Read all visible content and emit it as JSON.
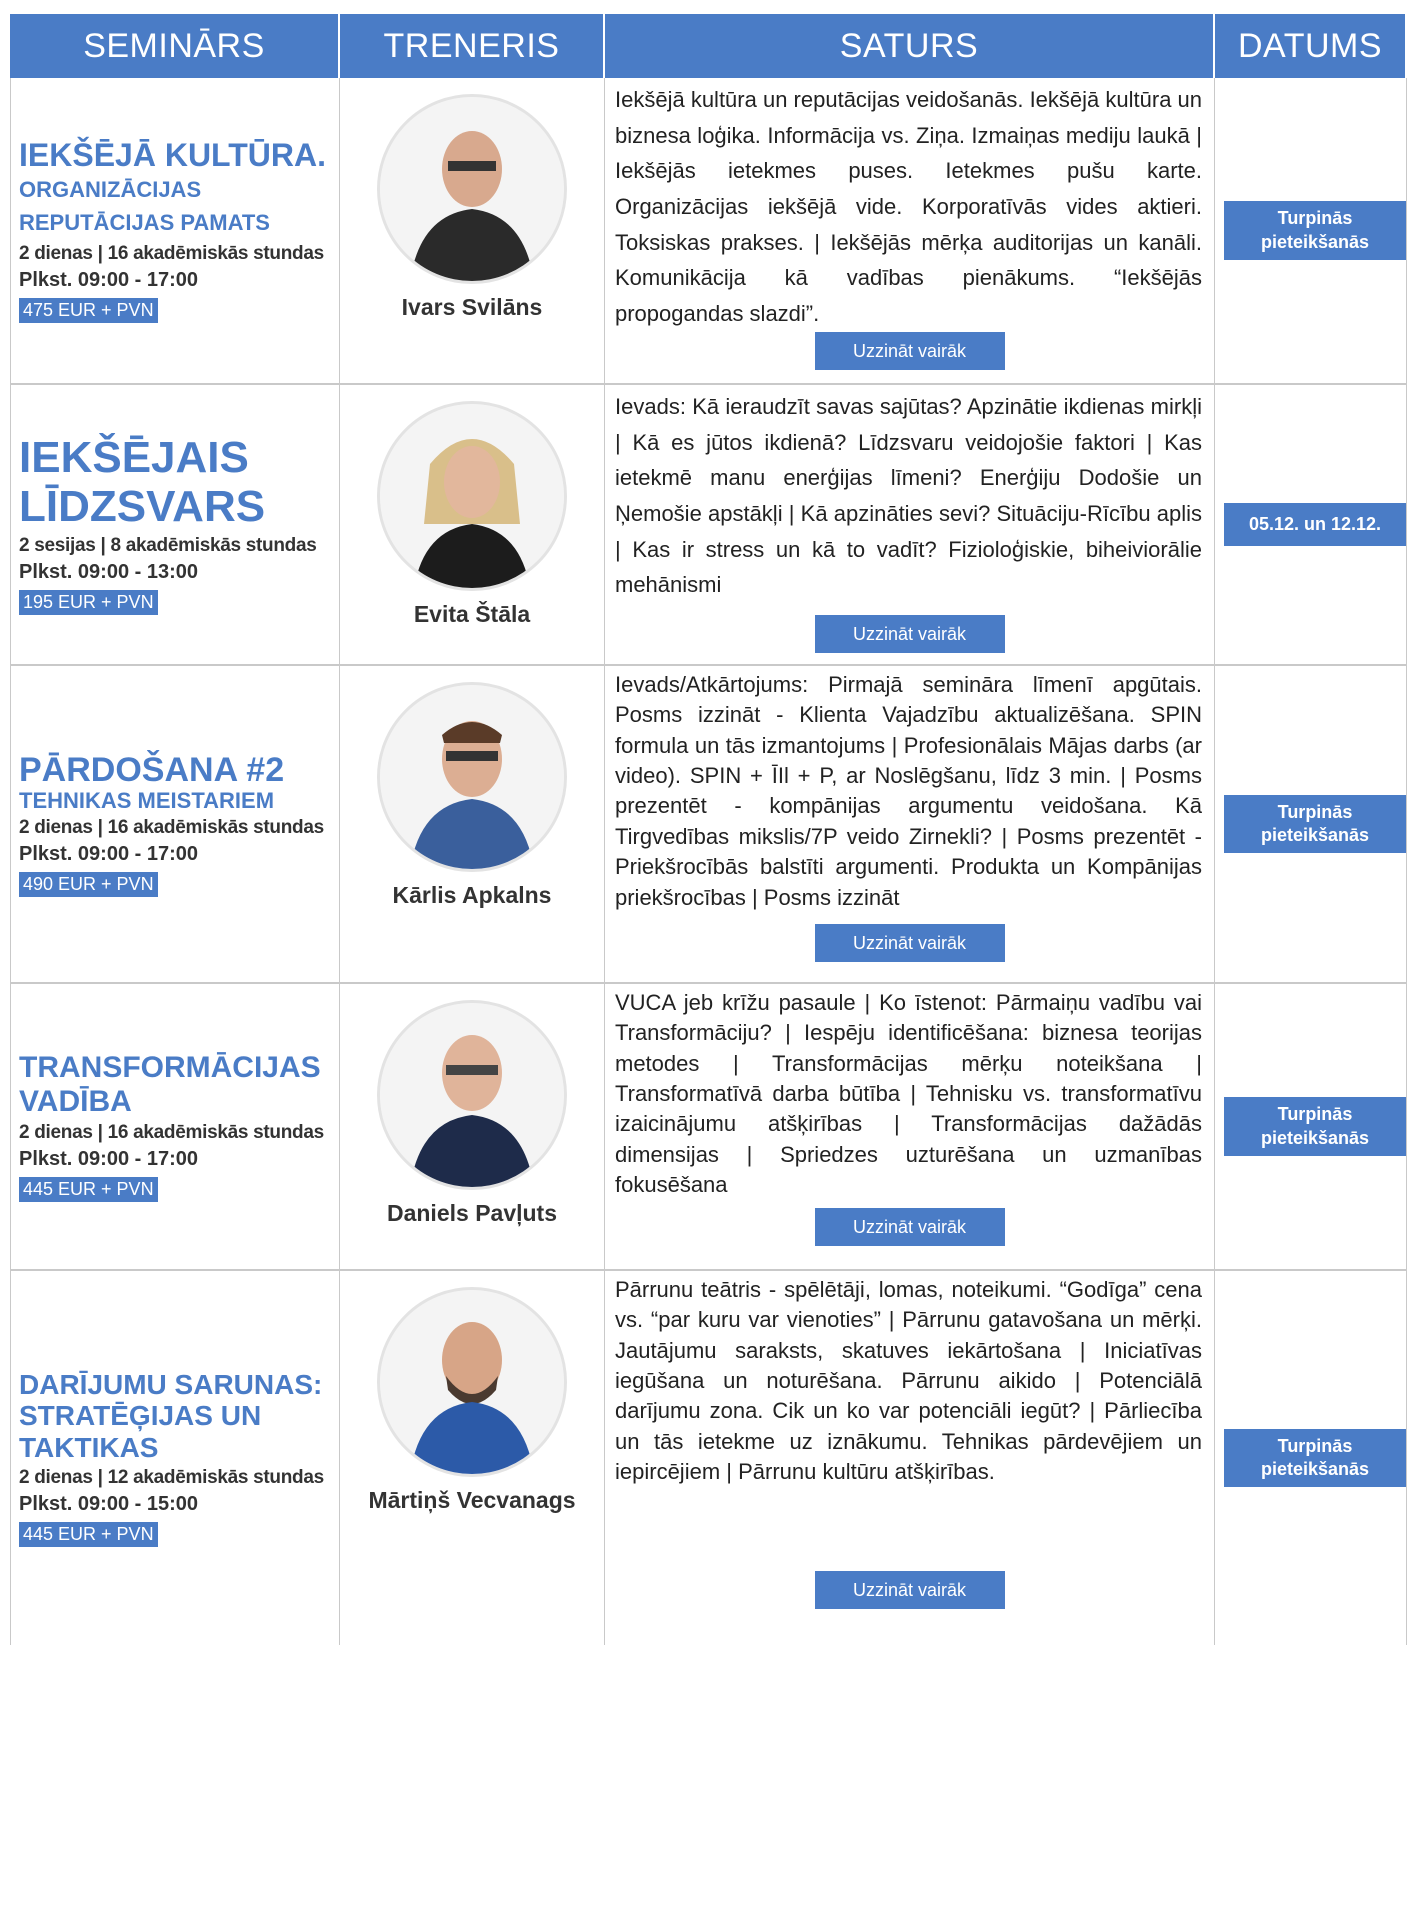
{
  "header": {
    "col1": "SEMINĀRS",
    "col2": "TRENERIS",
    "col3": "SATURS",
    "col4": "DATUMS"
  },
  "rows": [
    {
      "title": "IEKŠĒJĀ KULTŪRA.",
      "subtitle": "ORGANIZĀCIJAS REPUTĀCIJAS PAMATS",
      "duration": "2 dienas | 16 akadēmiskās stundas",
      "time": "Plkst. 09:00 - 17:00",
      "price": "475 EUR + PVN",
      "trainer": "Ivars Svilāns",
      "content": "Iekšējā kultūra un reputācijas veidošanās. Iekšējā kultūra un biznesa loģika. Informācija vs. Ziņa. Izmaiņas mediju laukā | Iekšējās ietekmes puses. Ietekmes pušu karte. Organizācijas iekšējā vide. Korporatīvās vides aktieri. Toksiskas prakses. | Iekšējās mērķa auditorijas un kanāli. Komunikācija kā vadības pienākums. “Iekšējās propogandas slazdi”.",
      "more": "Uzzināt vairāk",
      "date": "Turpinās pieteikšanās"
    },
    {
      "title": "IEKŠĒJAIS LĪDZSVARS",
      "subtitle": "",
      "duration": "2 sesijas | 8 akadēmiskās stundas",
      "time": "Plkst. 09:00 - 13:00",
      "price": "195 EUR + PVN",
      "trainer": "Evita Štāla",
      "content": "Ievads: Kā ieraudzīt savas sajūtas? Apzinātie ikdienas mirkļi | Kā es jūtos ikdienā? Līdzsvaru veidojošie faktori | Kas ietekmē manu enerģijas līmeni? Enerģiju Dodošie un Ņemošie apstākļi | Kā apzināties sevi? Situāciju-Rīcību aplis | Kas ir stress un kā to vadīt? Fizioloģiskie, biheiviorālie mehānismi",
      "more": "Uzzināt vairāk",
      "date": "05.12. un 12.12."
    },
    {
      "title": "PĀRDOŠANA #2",
      "subtitle": "TEHNIKAS MEISTARIEM",
      "duration": "2 dienas | 16 akadēmiskās stundas",
      "time": "Plkst. 09:00 - 17:00",
      "price": "490 EUR + PVN",
      "trainer": "Kārlis Apkalns",
      "content": "Ievads/Atkārtojums: Pirmajā semināra līmenī apgūtais. Posms izzināt - Klienta Vajadzību aktualizēšana. SPIN formula un tās izmantojums | Profesionālais Mājas darbs (ar video). SPIN + ĪIl + P, ar Noslēgšanu, līdz 3 min. | Posms prezentēt - kompānijas argumentu veidošana. Kā Tirgvedības mikslis/7P veido Zirnekli? | Posms prezentēt - Priekšrocībās balstīti argumenti. Produkta un Kompānijas priekšrocības | Posms izzināt",
      "more": "Uzzināt vairāk",
      "date": "Turpinās pieteikšanās"
    },
    {
      "title": "TRANSFORMĀCIJAS VADĪBA",
      "subtitle": "",
      "duration": "2 dienas | 16 akadēmiskās stundas",
      "time": "Plkst. 09:00 - 17:00",
      "price": "445 EUR + PVN",
      "trainer": "Daniels Pavļuts",
      "content": "VUCA jeb krīžu pasaule | Ko īstenot: Pārmaiņu vadību vai Transformāciju? | Iespēju identificēšana: biznesa teorijas metodes | Transformācijas mērķu noteikšana | Transformatīvā darba būtība | Tehnisku vs. transformatīvu izaicinājumu atšķirības | Transformācijas dažādās dimensijas | Spriedzes uzturēšana un uzmanības fokusēšana",
      "more": "Uzzināt vairāk",
      "date": "Turpinās pieteikšanās"
    },
    {
      "title": "DARĪJUMU SARUNAS: STRATĒĢIJAS UN TAKTIKAS",
      "subtitle": "",
      "duration": "2 dienas | 12 akadēmiskās stundas",
      "time": "Plkst. 09:00 - 15:00",
      "price": "445 EUR + PVN",
      "trainer": "Mārtiņš Vecvanags",
      "content": "Pārrunu teātris - spēlētāji, lomas, noteikumi. “Godīga” cena vs. “par kuru var vienoties” | Pārrunu gatavošana un mērķi. Jautājumu saraksts, skatuves iekārtošana | Iniciatīvas iegūšana un noturēšana. Pārrunu aikido | Potenciālā darījumu zona. Cik un ko var potenciāli iegūt? | Pārliecība un tās ietekme uz iznākumu. Tehnikas pārdevējiem un iepircējiem | Pārrunu kultūru atšķirības.",
      "more": "Uzzināt vairāk",
      "date": "Turpinās pieteikšanās"
    }
  ]
}
